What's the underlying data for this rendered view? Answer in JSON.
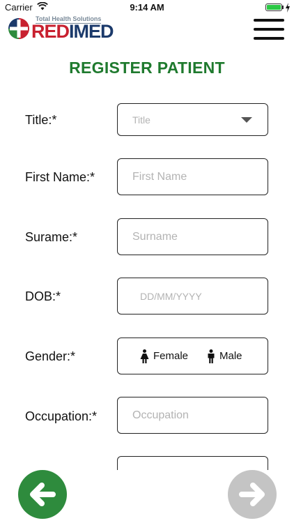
{
  "status_bar": {
    "carrier": "Carrier",
    "time": "9:14 AM"
  },
  "header": {
    "brand_tagline": "Total Health Solutions",
    "brand_name_part1": "RED",
    "brand_name_part2": "IMED",
    "menu_icon": "hamburger-menu-icon"
  },
  "page": {
    "title": "REGISTER PATIENT"
  },
  "form": {
    "title_field": {
      "label": "Title:*",
      "placeholder": "Title"
    },
    "first_name": {
      "label": "First Name:*",
      "placeholder": "First Name"
    },
    "surname": {
      "label": "Surame:*",
      "placeholder": "Surname"
    },
    "dob": {
      "label": "DOB:*",
      "placeholder": "DD/MM/YYYY"
    },
    "gender": {
      "label": "Gender:*",
      "female": "Female",
      "male": "Male"
    },
    "occupation": {
      "label": "Occupation:*",
      "placeholder": "Occupation"
    }
  },
  "navigation": {
    "back_icon": "arrow-left-icon",
    "next_icon": "arrow-right-icon"
  },
  "colors": {
    "accent_green": "#2e8b3d",
    "title_green": "#1f7a2e",
    "brand_red": "#c8202f",
    "brand_navy": "#1b3a6b",
    "disabled_gray": "#c4c4c4"
  }
}
